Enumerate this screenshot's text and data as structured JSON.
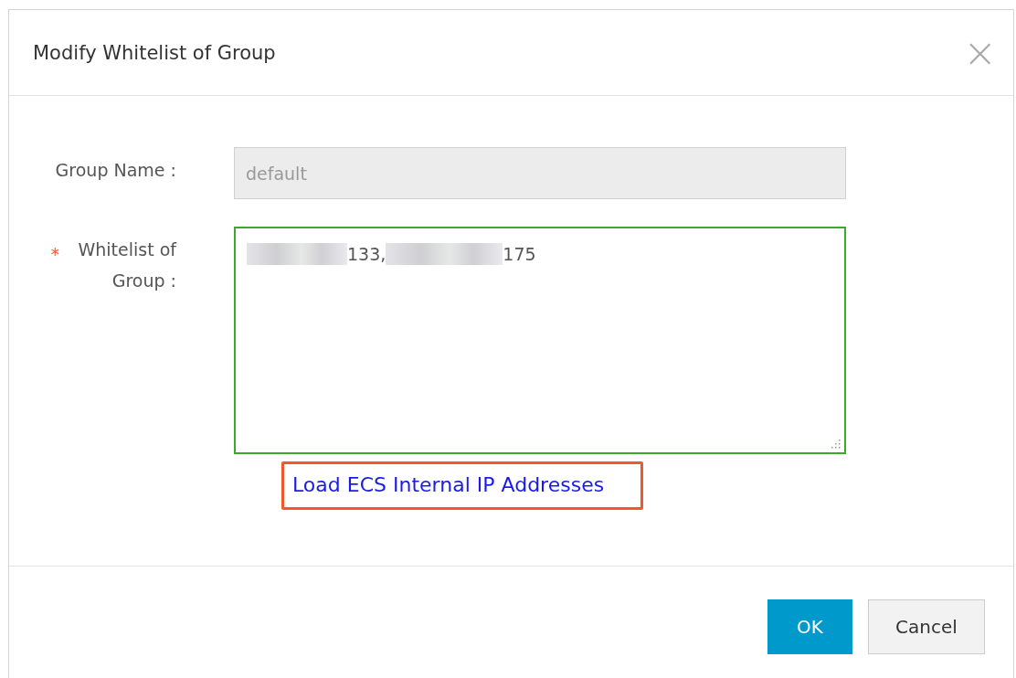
{
  "dialog": {
    "title": "Modify Whitelist of Group",
    "close": "×"
  },
  "fields": [
    {
      "kind": "input",
      "label": "Group Name :",
      "value": "default",
      "disabled": true
    },
    {
      "kind": "textarea",
      "label": "Whitelist of Group :",
      "required_mark": "*",
      "fragments": [
        "133,",
        "175"
      ],
      "focused": true
    }
  ],
  "link": {
    "label": "Load ECS Internal IP Addresses",
    "highlighted": true
  },
  "buttons": [
    {
      "label": "OK",
      "kind": "primary"
    },
    {
      "label": "Cancel",
      "kind": "secondary"
    }
  ]
}
